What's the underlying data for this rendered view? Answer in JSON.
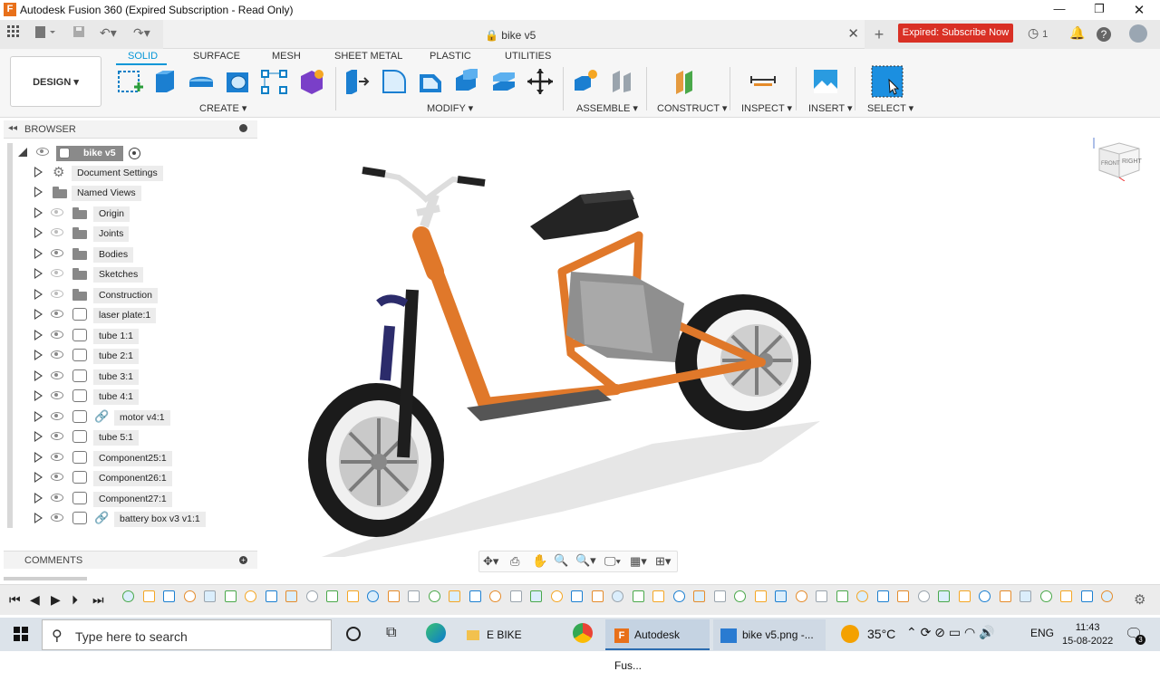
{
  "titlebar": {
    "app_title": "Autodesk Fusion 360 (Expired Subscription - Read Only)"
  },
  "doc": {
    "tab_title": "bike v5",
    "expired_label": "Expired: Subscribe Now",
    "jobs_count": "1"
  },
  "ribbon": {
    "design_label": "DESIGN ▾",
    "tabs": [
      "SOLID",
      "SURFACE",
      "MESH",
      "SHEET METAL",
      "PLASTIC",
      "UTILITIES"
    ],
    "groups": [
      "CREATE ▾",
      "MODIFY ▾",
      "ASSEMBLE ▾",
      "CONSTRUCT ▾",
      "INSPECT ▾",
      "INSERT ▾",
      "SELECT ▾"
    ]
  },
  "browser": {
    "title": "BROWSER",
    "root": "bike v5",
    "items": [
      "Document Settings",
      "Named Views",
      "Origin",
      "Joints",
      "Bodies",
      "Sketches",
      "Construction",
      "laser plate:1",
      "tube 1:1",
      "tube 2:1",
      "tube 3:1",
      "tube 4:1",
      "motor v4:1",
      "tube 5:1",
      "Component25:1",
      "Component26:1",
      "Component27:1",
      "battery box v3 v1:1"
    ]
  },
  "comments": {
    "title": "COMMENTS"
  },
  "viewcube": {
    "front": "FRONT",
    "right": "RIGHT"
  },
  "taskbar": {
    "search_placeholder": "Type here to search",
    "apps": [
      "E BIKE",
      "Autodesk Fus...",
      "bike v5.png -..."
    ],
    "temperature": "35°C",
    "language": "ENG",
    "time": "11:43",
    "date": "15-08-2022",
    "notif_count": "3"
  },
  "colors": {
    "accent": "#0696d7",
    "expired": "#d93025",
    "frame": "#e0782a"
  }
}
